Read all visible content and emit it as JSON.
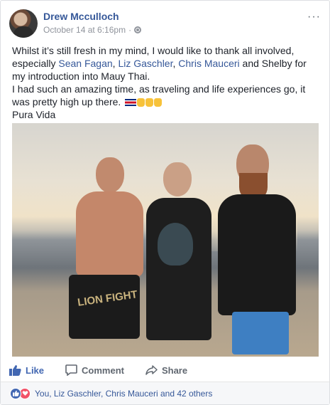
{
  "post": {
    "author": "Drew Mcculloch",
    "timestamp": "October 14 at 6:16pm",
    "separator": "·",
    "privacy_icon": "globe-icon",
    "more_label": "···",
    "text": {
      "line1_a": "Whilst it’s still fresh in my mind, I would like to thank all involved, especially",
      "mention1": "Sean Fagan",
      "comma1": ", ",
      "mention2": "Liz Gaschler",
      "comma2": ", ",
      "mention3": "Chris Mauceri",
      "line2_b": " and Shelby for my introduction into Mauy Thai.",
      "line3": "I had such an amazing time, as traveling and life experiences go, it was pretty high up there.",
      "line4": "Pura Vida"
    },
    "photo": {
      "shorts_text": "LION FIGHT"
    }
  },
  "actions": {
    "like": "Like",
    "comment": "Comment",
    "share": "Share",
    "like_color": "#4267b2"
  },
  "reactions": {
    "summary": "You, Liz Gaschler, Chris Mauceri and 42 others",
    "types": [
      "like",
      "love"
    ]
  },
  "colors": {
    "link": "#365899",
    "muted": "#90949c",
    "action": "#606770"
  }
}
